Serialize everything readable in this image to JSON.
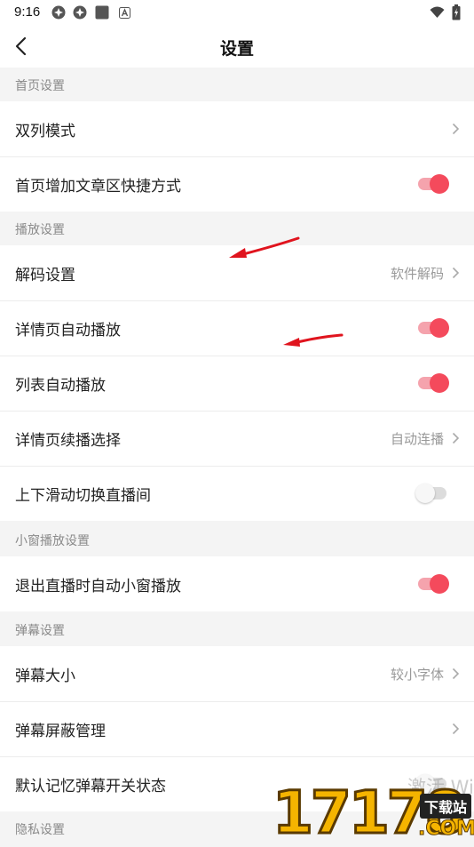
{
  "status_bar": {
    "time": "9:16"
  },
  "nav": {
    "title": "设置"
  },
  "sections": {
    "home": "首页设置",
    "playback": "播放设置",
    "mini_window": "小窗播放设置",
    "danmaku": "弹幕设置",
    "privacy": "隐私设置"
  },
  "rows": {
    "dual_column": {
      "label": "双列模式"
    },
    "home_shortcut": {
      "label": "首页增加文章区快捷方式",
      "enabled": true
    },
    "decode": {
      "label": "解码设置",
      "value": "软件解码"
    },
    "detail_autoplay": {
      "label": "详情页自动播放",
      "enabled": true
    },
    "list_autoplay": {
      "label": "列表自动播放",
      "enabled": true
    },
    "detail_continue": {
      "label": "详情页续播选择",
      "value": "自动连播"
    },
    "swipe_live": {
      "label": "上下滑动切换直播间",
      "enabled": false
    },
    "exit_live_mini": {
      "label": "退出直播时自动小窗播放",
      "enabled": true
    },
    "danmaku_size": {
      "label": "弹幕大小",
      "value": "较小字体"
    },
    "danmaku_block": {
      "label": "弹幕屏蔽管理"
    },
    "danmaku_remember": {
      "label": "默认记忆弹幕开关状态",
      "enabled": false
    }
  },
  "watermark": {
    "brand_number": "17178",
    "badge": "下载站",
    "domain": ".COM",
    "overlay_text": "激活 Wi"
  },
  "colors": {
    "accent": "#f44a5c",
    "annotation_arrow": "#e0141e"
  }
}
